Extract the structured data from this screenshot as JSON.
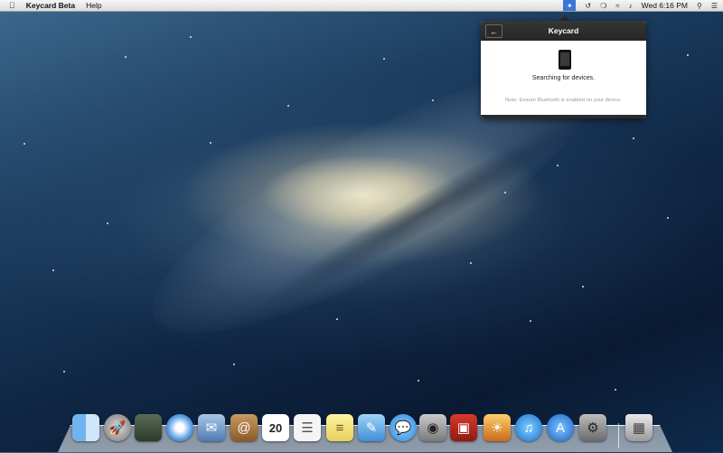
{
  "menubar": {
    "apple_icon": "apple-icon",
    "app_name": "Keycard Beta",
    "menus": [
      "Help"
    ],
    "clock": "Wed 6:16 PM"
  },
  "popover": {
    "title": "Keycard",
    "status": "Searching for devices.",
    "note": "Note: Ensure Bluetooth is enabled on your device.",
    "back_icon": "arrow-left-icon",
    "device_icon": "phone-icon"
  },
  "dock": {
    "items": [
      "finder-icon",
      "launchpad-icon",
      "mission-control-icon",
      "safari-icon",
      "mail-icon",
      "contacts-icon",
      "calendar-icon",
      "reminders-icon",
      "notes-icon",
      "keycard-icon",
      "messages-icon",
      "facetime-icon",
      "photo-booth-icon",
      "iphoto-icon",
      "itunes-icon",
      "app-store-icon",
      "system-preferences-icon",
      "trash-icon"
    ],
    "calendar_day": "20"
  }
}
